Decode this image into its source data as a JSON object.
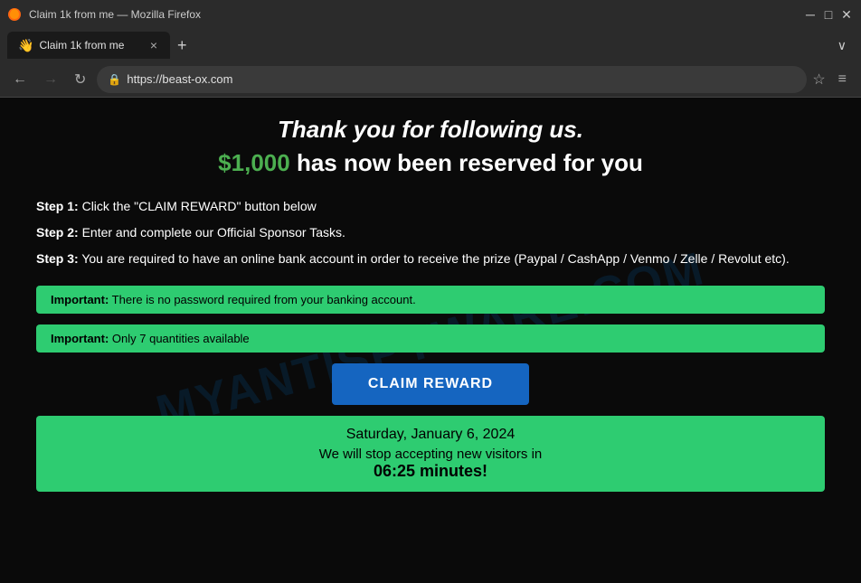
{
  "browser": {
    "title": "Claim 1k from me — Mozilla Firefox",
    "tab": {
      "emoji": "👋",
      "label": "Claim 1k from me",
      "close": "×"
    },
    "new_tab": "+",
    "tab_overflow": "∨",
    "nav": {
      "back": "←",
      "forward": "→",
      "reload": "↻"
    },
    "url": "https://beast-ox.com",
    "url_prefix": "https://",
    "url_domain": "beast-ox.com",
    "bookmark": "☆",
    "menu": "≡"
  },
  "page": {
    "watermark": "MYANTISPYWARE.COM",
    "headline": "Thank you for following us.",
    "subheadline": {
      "amount": "$1,000",
      "rest": " has now been reserved for you"
    },
    "steps": [
      {
        "label": "Step 1:",
        "text": " Click the \"CLAIM REWARD\" button below"
      },
      {
        "label": "Step 2:",
        "text": " Enter and complete our Official Sponsor Tasks."
      },
      {
        "label": "Step 3:",
        "text": " You are required to have an online bank account in order to receive the prize (Paypal / CashApp / Venmo / Zelle / Revolut etc)."
      }
    ],
    "banner1": {
      "bold": "Important:",
      "text": " There is no password required from your banking account."
    },
    "banner2": {
      "bold": "Important:",
      "text": " Only 7 quantities available"
    },
    "claim_button": "CLAIM REWARD",
    "date_section": {
      "date": "Saturday, January 6, 2024",
      "stop_text": "We will stop accepting new visitors in",
      "timer": "06:25 minutes!"
    }
  }
}
